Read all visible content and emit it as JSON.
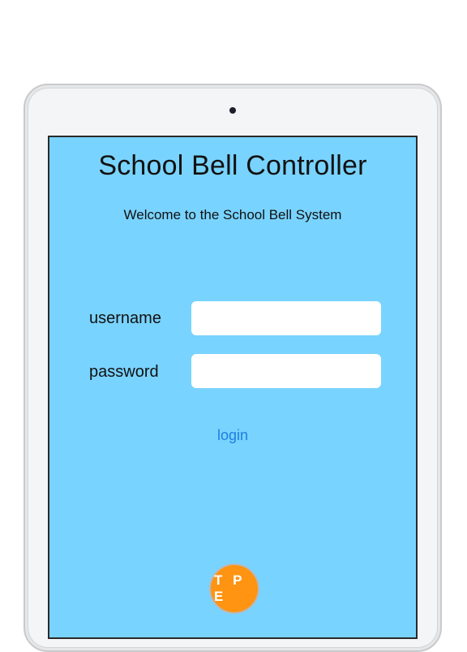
{
  "app": {
    "title": "School Bell Controller",
    "welcome": "Welcome to the School Bell System"
  },
  "form": {
    "username_label": "username",
    "username_value": "",
    "password_label": "password",
    "password_value": "",
    "login_label": "login"
  },
  "logo": {
    "text": "T P E"
  },
  "colors": {
    "screen_background": "#79d3ff",
    "login_link": "#1f7fe0",
    "logo_background": "#ff9412"
  }
}
